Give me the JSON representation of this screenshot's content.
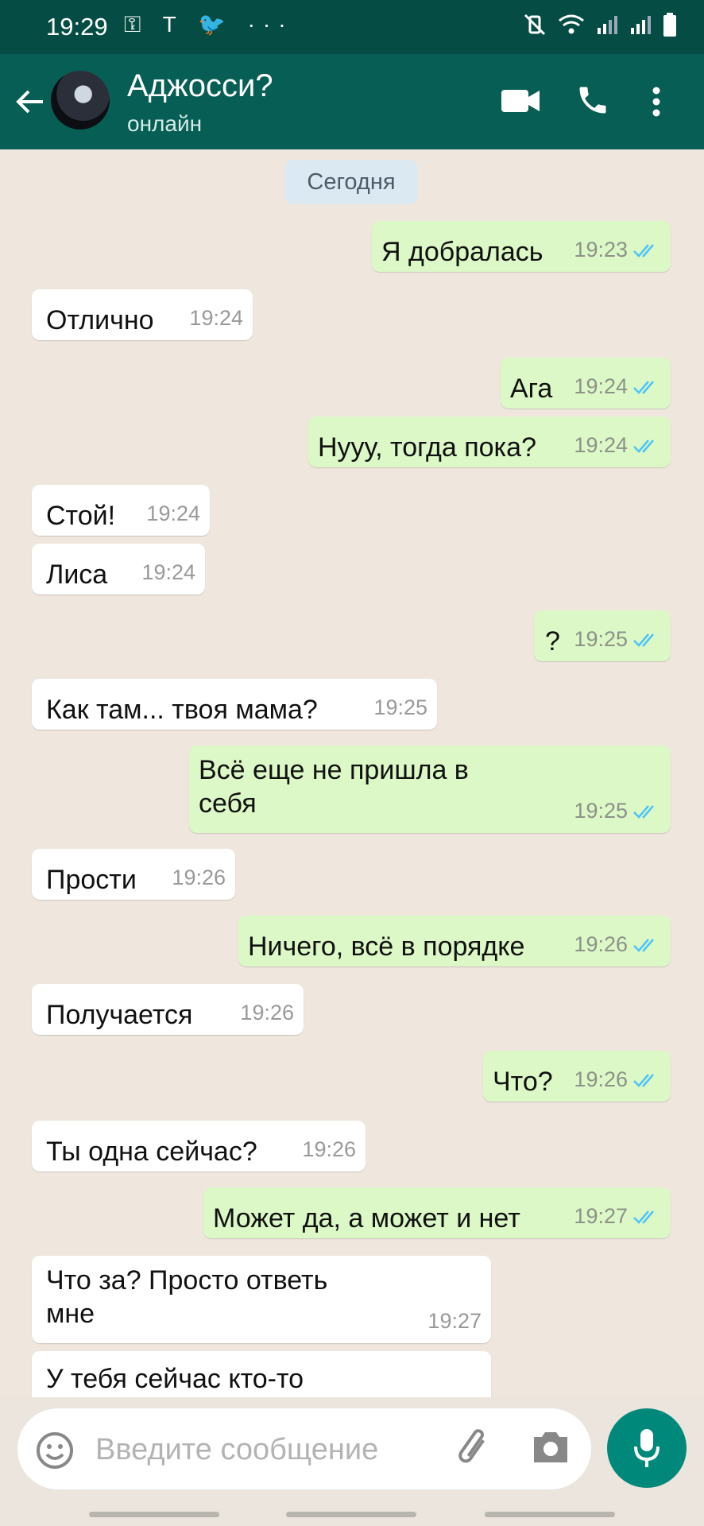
{
  "status_bar": {
    "time": "19:29",
    "left_icons": [
      "key-icon",
      "tinkoff-icon",
      "twitter-icon",
      "more-dots-icon"
    ],
    "left_glyphs": "⚿ T 🐦 ···",
    "right_icons": [
      "mute-vibrate-icon",
      "wifi-icon",
      "signal-icon",
      "signal-icon-2",
      "battery-icon"
    ]
  },
  "header": {
    "contact_name": "Аджосси?",
    "contact_status": "онлайн",
    "icons": [
      "back-arrow-icon",
      "avatar",
      "video-call-icon",
      "voice-call-icon",
      "more-vert-icon"
    ]
  },
  "chat": {
    "date_separator": "Сегодня",
    "messages": [
      {
        "dir": "out",
        "text": "Я добралась",
        "time": "19:23",
        "read": true
      },
      {
        "dir": "in",
        "text": "Отлично",
        "time": "19:24"
      },
      {
        "dir": "out",
        "text": "Ага",
        "time": "19:24",
        "read": true
      },
      {
        "dir": "out",
        "text": "Нууу, тогда пока?",
        "time": "19:24",
        "read": true
      },
      {
        "dir": "in",
        "text": "Стой!",
        "time": "19:24"
      },
      {
        "dir": "in",
        "text": "Лиса",
        "time": "19:24"
      },
      {
        "dir": "out",
        "text": "?",
        "time": "19:25",
        "read": true
      },
      {
        "dir": "in",
        "text": "Как там... твоя мама?",
        "time": "19:25"
      },
      {
        "dir": "out",
        "text": "Всё еще не пришла в себя",
        "time": "19:25",
        "read": true
      },
      {
        "dir": "in",
        "text": "Прости",
        "time": "19:26"
      },
      {
        "dir": "out",
        "text": "Ничего, всё в порядке",
        "time": "19:26",
        "read": true
      },
      {
        "dir": "in",
        "text": "Получается",
        "time": "19:26"
      },
      {
        "dir": "out",
        "text": "Что?",
        "time": "19:26",
        "read": true
      },
      {
        "dir": "in",
        "text": "Ты одна сейчас?",
        "time": "19:26"
      },
      {
        "dir": "out",
        "text": "Может да, а может и нет",
        "time": "19:27",
        "read": true
      },
      {
        "dir": "in",
        "text": "Что за? Просто ответь мне",
        "time": "19:27"
      },
      {
        "dir": "in",
        "text": "У тебя сейчас кто-то",
        "time": ""
      }
    ]
  },
  "composer": {
    "placeholder": "Введите сообщение",
    "value": "",
    "icons": [
      "emoji-icon",
      "attach-icon",
      "camera-icon",
      "mic-icon"
    ]
  },
  "colors": {
    "status_bar": "#054d44",
    "app_bar": "#075e54",
    "outgoing_bubble": "#dcf8c6",
    "incoming_bubble": "#ffffff",
    "read_ticks": "#4fc3f7",
    "mic_button": "#00897b"
  }
}
